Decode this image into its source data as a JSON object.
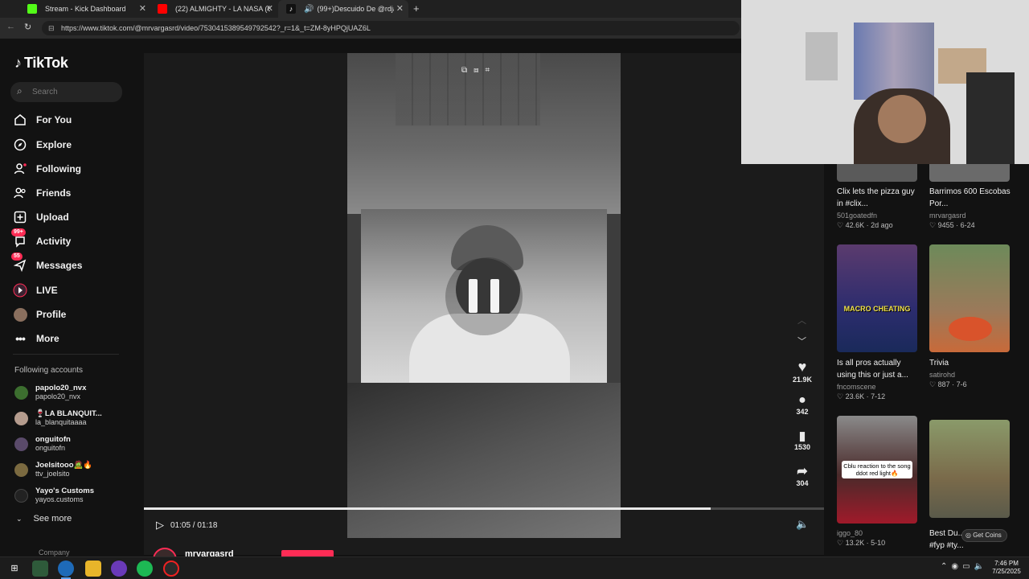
{
  "browser": {
    "tabs": [
      {
        "title": "Stream - Kick Dashboard",
        "color": "#53fc18"
      },
      {
        "title": "(22) ALMIGHTY - LA NASA (OFFIC",
        "color": "#ff0000"
      },
      {
        "title": "(99+)Descuido De @rdjavi",
        "color": "#ffffff"
      }
    ],
    "url": "https://www.tiktok.com/@mrvargasrd/video/7530415389549792542?_r=1&_t=ZM-8yHPQjUAZ6L"
  },
  "sidebar": {
    "logo": "TikTok",
    "search_placeholder": "Search",
    "nav": [
      {
        "label": "For You",
        "icon": "home-icon"
      },
      {
        "label": "Explore",
        "icon": "compass-icon"
      },
      {
        "label": "Following",
        "icon": "following-icon"
      },
      {
        "label": "Friends",
        "icon": "friends-icon"
      },
      {
        "label": "Upload",
        "icon": "upload-icon"
      },
      {
        "label": "Activity",
        "icon": "activity-icon",
        "badge": "99+"
      },
      {
        "label": "Messages",
        "icon": "messages-icon",
        "badge": "55"
      },
      {
        "label": "LIVE",
        "icon": "live-icon"
      },
      {
        "label": "Profile",
        "icon": "profile-icon"
      },
      {
        "label": "More",
        "icon": "more-icon"
      }
    ],
    "following_title": "Following accounts",
    "accounts": [
      {
        "name": "papolo20_nvx",
        "handle": "papolo20_nvx"
      },
      {
        "name": "🍷LA BLANQUIT...",
        "handle": "la_blanquitaaaa"
      },
      {
        "name": "onguitofn",
        "handle": "onguitofn"
      },
      {
        "name": "Joelsitooo🧟🔥",
        "handle": "ttv_joelsito"
      },
      {
        "name": "Yayo's Customs",
        "handle": "yayos.customs"
      }
    ],
    "see_more": "See more",
    "company": "Company"
  },
  "player": {
    "time": "01:05 / 01:18",
    "progress": 0.833,
    "author": "mrvargasrd",
    "likes": "21.9K",
    "comments": "342",
    "saves": "1530",
    "shares": "304"
  },
  "recommended": [
    {
      "title": "Clix lets the pizza guy in #clix...",
      "author": "501goatedfn",
      "stats": "42.6K · 2d ago"
    },
    {
      "title": "Barrimos 600 Escobas Por...",
      "author": "mrvargasrd",
      "stats": "9455 · 6-24"
    },
    {
      "title": "Is all pros actually using this or just a...",
      "author": "fncomscene",
      "stats": "23.6K · 7-12",
      "thumb_text": "MACRO CHEATING"
    },
    {
      "title": "Trivia",
      "author": "satirohd",
      "stats": "887 · 7-6"
    },
    {
      "title": "",
      "author": "iggo_80",
      "stats": "13.2K · 5-10",
      "thumb_text": "Cblu reaction to the song ddot red light🔥"
    },
    {
      "title": "Best Du... #fyp #fyp #fyp #ty...",
      "author": "",
      "stats": "",
      "button": "Get Coins"
    }
  ],
  "taskbar": {
    "time": "7:46 PM",
    "date": "7/25/2025"
  }
}
